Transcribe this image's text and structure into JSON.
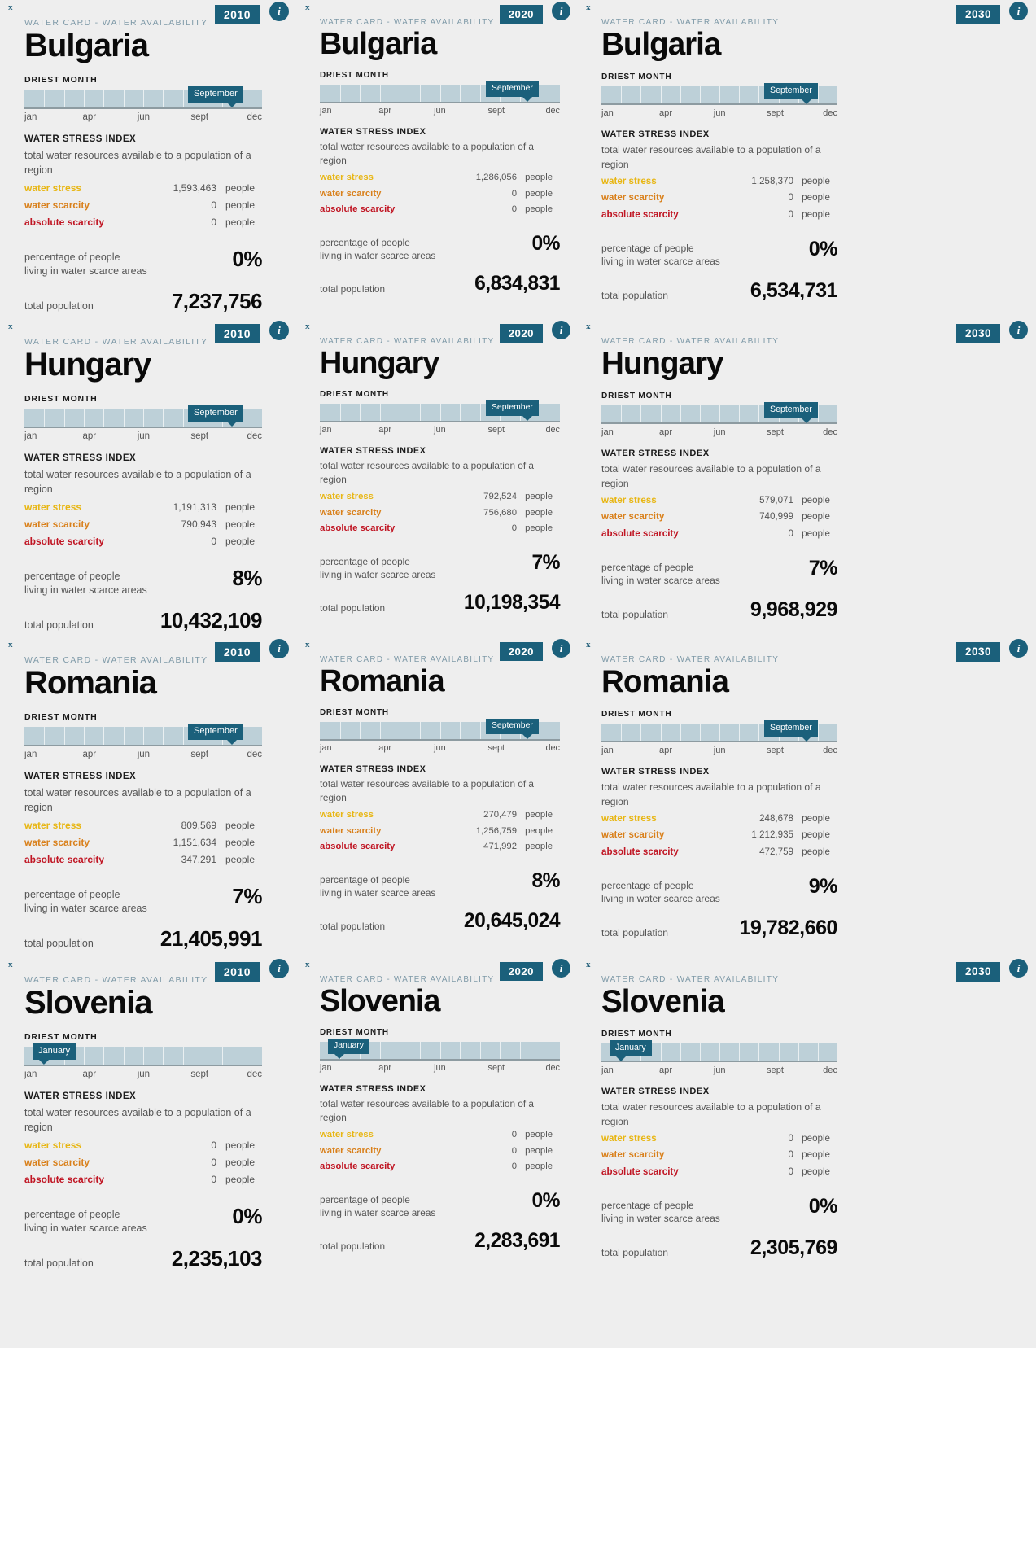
{
  "ui": {
    "close_label": "x",
    "info_label": "i",
    "eyebrow": "WATER CARD - WATER AVAILABILITY",
    "driest_month_label": "DRIEST MONTH",
    "wsi_title": "WATER STRESS INDEX",
    "wsi_desc": "total water resources available to a population of a region",
    "key_water_stress": "water stress",
    "key_water_scarcity": "water scarcity",
    "key_absolute_scarcity": "absolute scarcity",
    "unit_people": "people",
    "pct_label_line1": "percentage of people",
    "pct_label_line2": "living in water scarce areas",
    "pop_label": "total population",
    "month_ticks": [
      "jan",
      "apr",
      "jun",
      "sept",
      "dec"
    ]
  },
  "colors": {
    "accent": "#1b607b",
    "slider_track": "#bdd0d8",
    "water_stress": "#e8b613",
    "water_scarcity": "#d9801b",
    "absolute_scarcity": "#c01523",
    "card_bg": "#eeeeee",
    "eyebrow": "#7f9aa8"
  },
  "cards": [
    {
      "country": "Bulgaria",
      "year": "2010",
      "driest_month": "September",
      "water_stress": "1,593,463",
      "water_scarcity": "0",
      "absolute_scarcity": "0",
      "percentage": "0%",
      "total_population": "7,237,756"
    },
    {
      "country": "Bulgaria",
      "year": "2020",
      "driest_month": "September",
      "water_stress": "1,286,056",
      "water_scarcity": "0",
      "absolute_scarcity": "0",
      "percentage": "0%",
      "total_population": "6,834,831"
    },
    {
      "country": "Bulgaria",
      "year": "2030",
      "driest_month": "September",
      "water_stress": "1,258,370",
      "water_scarcity": "0",
      "absolute_scarcity": "0",
      "percentage": "0%",
      "total_population": "6,534,731"
    },
    {
      "country": "Hungary",
      "year": "2010",
      "driest_month": "September",
      "water_stress": "1,191,313",
      "water_scarcity": "790,943",
      "absolute_scarcity": "0",
      "percentage": "8%",
      "total_population": "10,432,109"
    },
    {
      "country": "Hungary",
      "year": "2020",
      "driest_month": "September",
      "water_stress": "792,524",
      "water_scarcity": "756,680",
      "absolute_scarcity": "0",
      "percentage": "7%",
      "total_population": "10,198,354"
    },
    {
      "country": "Hungary",
      "year": "2030",
      "driest_month": "September",
      "water_stress": "579,071",
      "water_scarcity": "740,999",
      "absolute_scarcity": "0",
      "percentage": "7%",
      "total_population": "9,968,929"
    },
    {
      "country": "Romania",
      "year": "2010",
      "driest_month": "September",
      "water_stress": "809,569",
      "water_scarcity": "1,151,634",
      "absolute_scarcity": "347,291",
      "percentage": "7%",
      "total_population": "21,405,991"
    },
    {
      "country": "Romania",
      "year": "2020",
      "driest_month": "September",
      "water_stress": "270,479",
      "water_scarcity": "1,256,759",
      "absolute_scarcity": "471,992",
      "percentage": "8%",
      "total_population": "20,645,024"
    },
    {
      "country": "Romania",
      "year": "2030",
      "driest_month": "September",
      "water_stress": "248,678",
      "water_scarcity": "1,212,935",
      "absolute_scarcity": "472,759",
      "percentage": "9%",
      "total_population": "19,782,660"
    },
    {
      "country": "Slovenia",
      "year": "2010",
      "driest_month": "January",
      "water_stress": "0",
      "water_scarcity": "0",
      "absolute_scarcity": "0",
      "percentage": "0%",
      "total_population": "2,235,103"
    },
    {
      "country": "Slovenia",
      "year": "2020",
      "driest_month": "January",
      "water_stress": "0",
      "water_scarcity": "0",
      "absolute_scarcity": "0",
      "percentage": "0%",
      "total_population": "2,283,691"
    },
    {
      "country": "Slovenia",
      "year": "2030",
      "driest_month": "January",
      "water_stress": "0",
      "water_scarcity": "0",
      "absolute_scarcity": "0",
      "percentage": "0%",
      "total_population": "2,305,769"
    }
  ]
}
